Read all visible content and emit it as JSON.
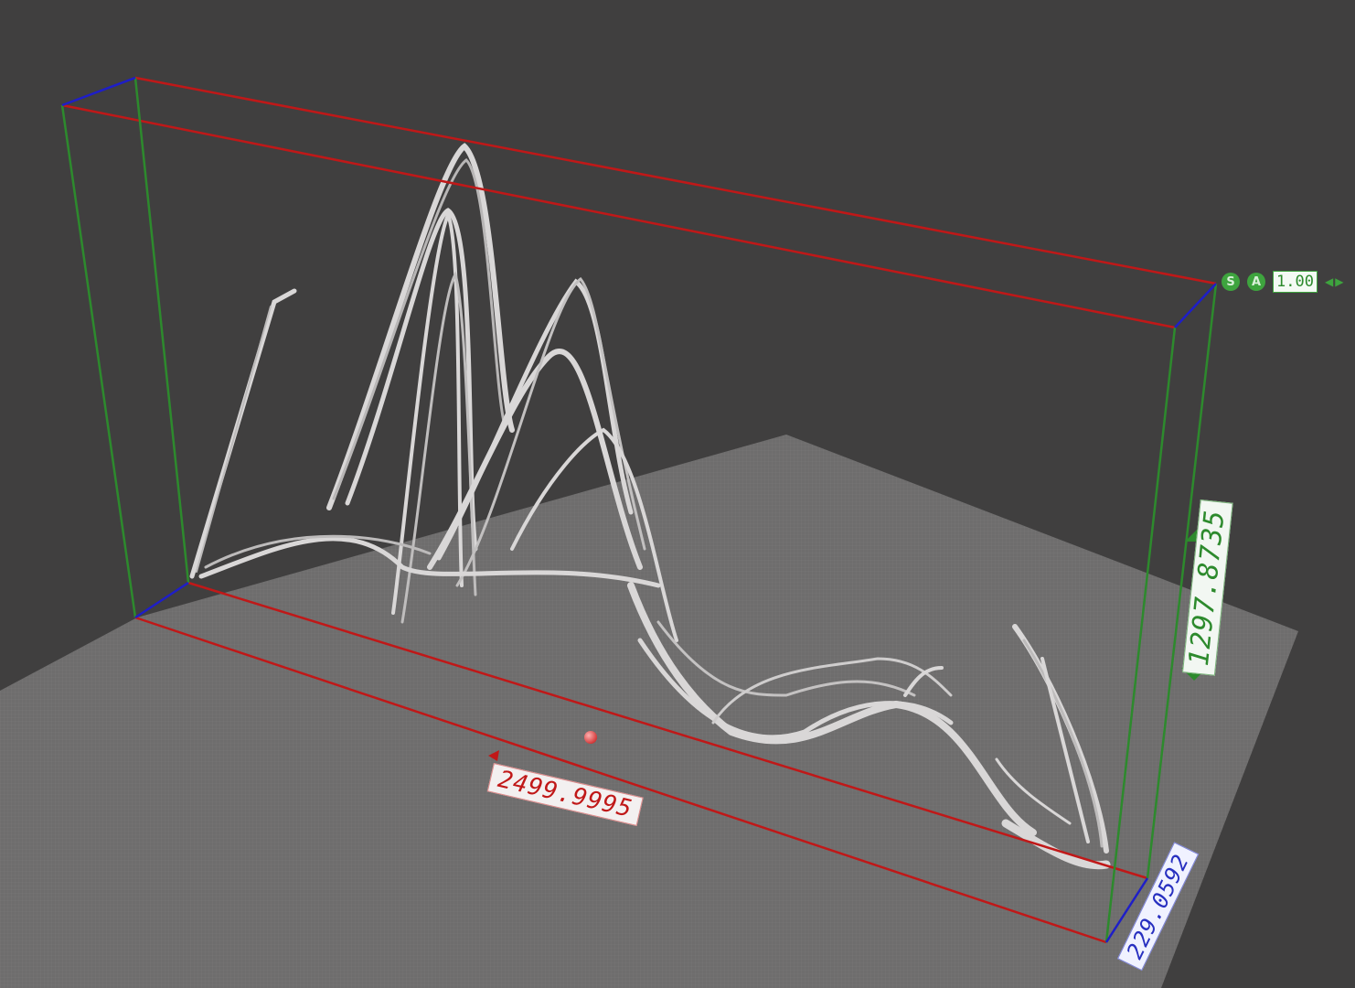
{
  "viewport": {
    "background_color": "#403f3f",
    "floor_color": "#6e6d6d"
  },
  "bounding_box": {
    "x_edge_color": "#c01818",
    "y_edge_color": "#2d8a2d",
    "z_edge_color": "#1e1ec8"
  },
  "dimensions": {
    "x_length": "2499.9995",
    "y_height": "1297.8735",
    "z_depth": "229.0592"
  },
  "toolbar": {
    "snap_label": "S",
    "snap_icon": "snap-icon",
    "align_label": "A",
    "align_icon": "align-icon",
    "scale_value": "1.00",
    "decrease_icon": "triangle-left-icon",
    "increase_icon": "triangle-right-icon"
  },
  "origin_marker": {
    "icon": "origin-sphere-icon",
    "color": "#e04040"
  },
  "model": {
    "color": "#d8d6d6"
  }
}
